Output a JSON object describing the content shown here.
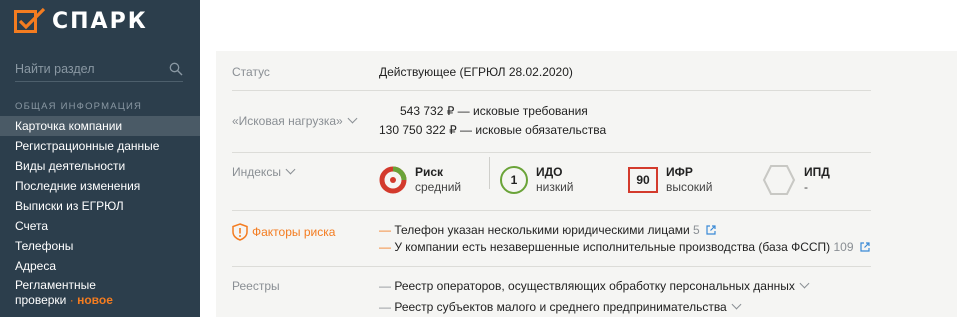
{
  "brand": {
    "name": "СПАРК",
    "accent": "#f47c20"
  },
  "sidebar": {
    "search_placeholder": "Найти раздел",
    "section_title": "ОБЩАЯ ИНФОРМАЦИЯ",
    "items": [
      {
        "label": "Карточка компании",
        "active": true
      },
      {
        "label": "Регистрационные данные"
      },
      {
        "label": "Виды деятельности"
      },
      {
        "label": "Последние изменения"
      },
      {
        "label": "Выписки из ЕГРЮЛ"
      },
      {
        "label": "Счета"
      },
      {
        "label": "Телефоны"
      },
      {
        "label": "Адреса"
      },
      {
        "label_line1": "Регламентные",
        "label_line2": "проверки",
        "dot": "·",
        "badge": "новое"
      }
    ]
  },
  "card": {
    "status": {
      "label": "Статус",
      "value": "Действующее (ЕГРЮЛ 28.02.2020)"
    },
    "claims": {
      "label": "«Исковая нагрузка»",
      "lines": [
        "543 732 ₽ — исковые требования",
        "130 750 322 ₽ — исковые обязательства"
      ]
    },
    "indices": {
      "label": "Индексы",
      "risk": {
        "title": "Риск",
        "level": "средний"
      },
      "ido": {
        "value": "1",
        "title": "ИДО",
        "level": "низкий"
      },
      "ifr": {
        "value": "90",
        "title": "ИФР",
        "level": "высокий"
      },
      "ipd": {
        "title": "ИПД",
        "level": "-"
      }
    },
    "risk_factors": {
      "label": "Факторы риска",
      "items": [
        {
          "text": "Телефон указан несколькими юридическими лицами",
          "count": "5"
        },
        {
          "text": "У компании есть незавершенные исполнительные производства (база ФССП)",
          "count": "109"
        }
      ]
    },
    "registries": {
      "label": "Реестры",
      "items": [
        "Реестр операторов, осуществляющих обработку персональных данных",
        "Реестр субъектов малого и среднего предпринимательства"
      ]
    }
  },
  "colors": {
    "sidebar_bg": "#2c3e4c",
    "ido_green": "#6aa338",
    "ifr_red": "#d33a2c",
    "risk_red": "#d33a2c",
    "risk_green": "#6aa338"
  }
}
